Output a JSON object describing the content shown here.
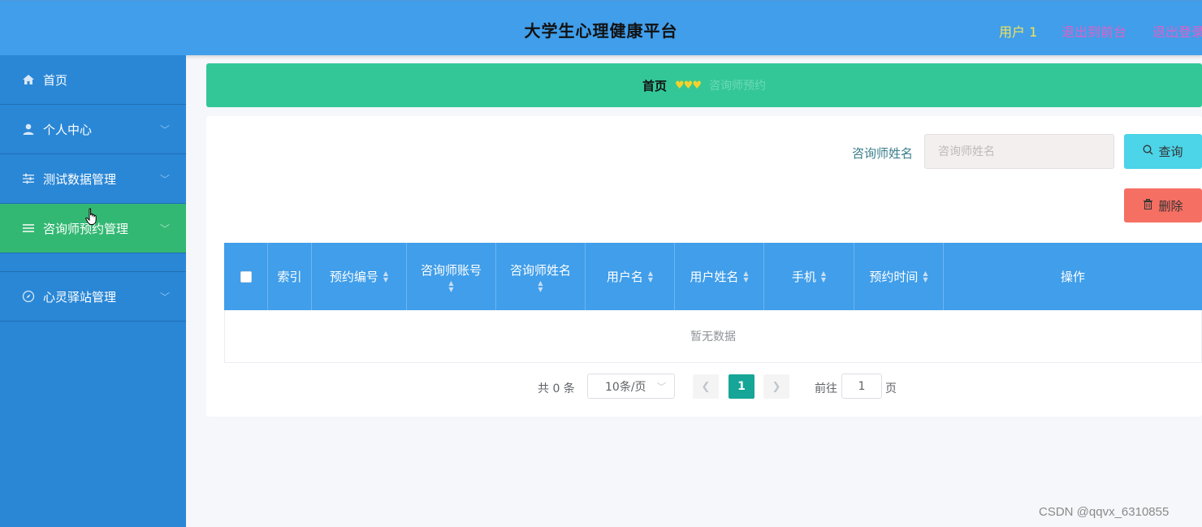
{
  "header": {
    "title": "大学生心理健康平台",
    "user": "用户 1",
    "back_front": "退出到前台",
    "logout": "退出登录"
  },
  "sidebar": {
    "items": [
      {
        "label": "首页",
        "icon": "home-icon"
      },
      {
        "label": "个人中心",
        "icon": "user-icon"
      },
      {
        "label": "测试数据管理",
        "icon": "sliders-icon"
      },
      {
        "label": "咨询师预约管理",
        "icon": "list-icon"
      },
      {
        "label": "心灵驿站管理",
        "icon": "compass-icon"
      }
    ],
    "active_index": 3
  },
  "breadcrumb": {
    "home": "首页",
    "separator": "♥♥♥",
    "current": "咨询师预约"
  },
  "search": {
    "label": "咨询师姓名",
    "placeholder": "咨询师姓名",
    "query_label": "查询",
    "delete_label": "删除"
  },
  "table": {
    "columns": [
      {
        "label": "",
        "checkbox": true
      },
      {
        "label": "索引"
      },
      {
        "label": "预约编号",
        "sortable": true
      },
      {
        "label": "咨询师账号",
        "sortable": true
      },
      {
        "label": "咨询师姓名",
        "sortable": true
      },
      {
        "label": "用户名",
        "sortable": true
      },
      {
        "label": "用户姓名",
        "sortable": true
      },
      {
        "label": "手机",
        "sortable": true
      },
      {
        "label": "预约时间",
        "sortable": true
      },
      {
        "label": "操作"
      }
    ],
    "empty_text": "暂无数据"
  },
  "pagination": {
    "total": "共 0 条",
    "page_size": "10条/页",
    "current_page": "1",
    "goto_label": "前往",
    "goto_value": "1",
    "page_unit": "页"
  },
  "watermark": "CSDN @qqvx_6310855"
}
